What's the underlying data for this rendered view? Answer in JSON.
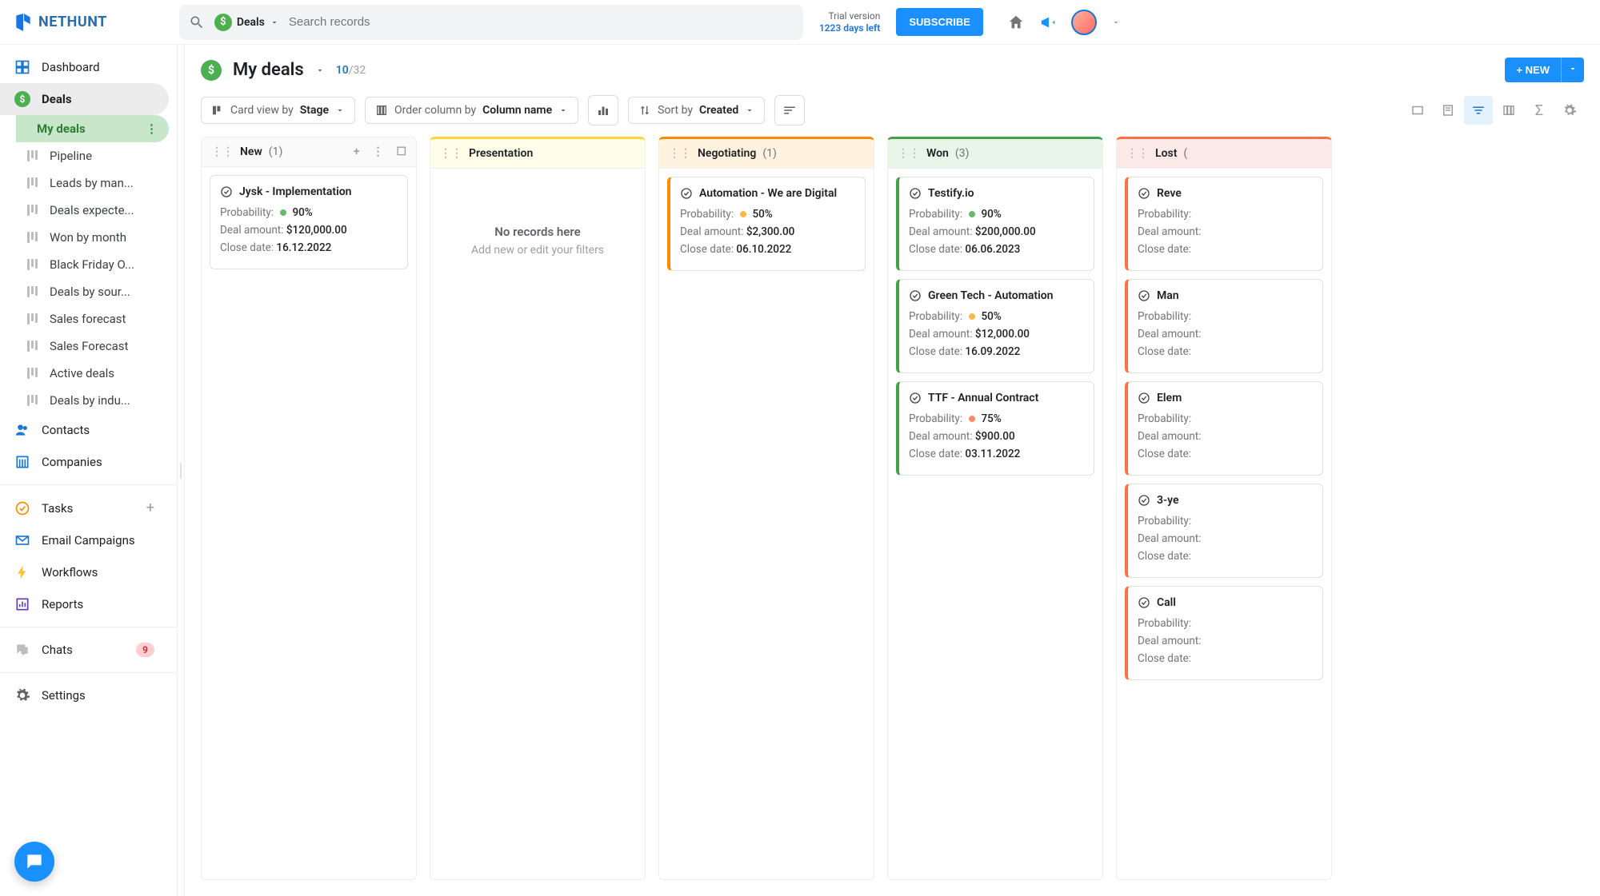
{
  "header": {
    "logo_text": "NETHUNT",
    "search_context": "Deals",
    "search_placeholder": "Search records",
    "trial_label": "Trial version",
    "trial_days": "1223 days left",
    "subscribe_label": "SUBSCRIBE"
  },
  "sidebar": {
    "dashboard": "Dashboard",
    "deals": "Deals",
    "subviews": [
      "My deals",
      "Pipeline",
      "Leads by man...",
      "Deals expecte...",
      "Won by month",
      "Black Friday O...",
      "Deals by sour...",
      "Sales forecast",
      "Sales Forecast",
      "Active deals",
      "Deals by indu..."
    ],
    "contacts": "Contacts",
    "companies": "Companies",
    "tasks": "Tasks",
    "email": "Email Campaigns",
    "workflows": "Workflows",
    "reports": "Reports",
    "chats": "Chats",
    "chats_badge": "9",
    "settings": "Settings"
  },
  "page": {
    "title": "My deals",
    "count_shown": "10",
    "count_total": "/32",
    "new_button": "+ NEW"
  },
  "toolbar": {
    "cardview_label": "Card view by",
    "cardview_value": "Stage",
    "order_label": "Order column by",
    "order_value": "Column name",
    "sort_label": "Sort by",
    "sort_value": "Created"
  },
  "board": {
    "columns": [
      {
        "key": "new",
        "name": "New",
        "count": "(1)",
        "class": "new"
      },
      {
        "key": "presentation",
        "name": "Presentation",
        "count": "",
        "class": "presentation"
      },
      {
        "key": "negotiating",
        "name": "Negotiating",
        "count": "(1)",
        "class": "negotiating"
      },
      {
        "key": "won",
        "name": "Won",
        "count": "(3)",
        "class": "won"
      },
      {
        "key": "lost",
        "name": "Lost",
        "count": "(",
        "class": "lost"
      }
    ],
    "empty_title": "No records here",
    "empty_sub": "Add new or edit your filters",
    "field_probability": "Probability:",
    "field_amount": "Deal amount:",
    "field_close": "Close date:"
  },
  "cards": {
    "new": [
      {
        "title": "Jysk - Implementation",
        "prob": "90%",
        "probClass": "green",
        "amount": "$120,000.00",
        "close": "16.12.2022",
        "cls": ""
      }
    ],
    "presentation": [],
    "negotiating": [
      {
        "title": "Automation - We are Digital",
        "prob": "50%",
        "probClass": "yellow",
        "amount": "$2,300.00",
        "close": "06.10.2022",
        "cls": "neg"
      }
    ],
    "won": [
      {
        "title": "Testify.io",
        "prob": "90%",
        "probClass": "green",
        "amount": "$200,000.00",
        "close": "06.06.2023",
        "cls": "won"
      },
      {
        "title": "Green Tech - Automation",
        "prob": "50%",
        "probClass": "yellow",
        "amount": "$12,000.00",
        "close": "16.09.2022",
        "cls": "won"
      },
      {
        "title": "TTF - Annual Contract",
        "prob": "75%",
        "probClass": "orange",
        "amount": "$900.00",
        "close": "03.11.2022",
        "cls": "won"
      }
    ],
    "lost": [
      {
        "title": "Reve",
        "prob": "",
        "probClass": "",
        "amount": "",
        "close": "",
        "cls": "lost"
      },
      {
        "title": "Man",
        "prob": "",
        "probClass": "",
        "amount": "",
        "close": "",
        "cls": "lost"
      },
      {
        "title": "Elem",
        "prob": "",
        "probClass": "",
        "amount": "",
        "close": "",
        "cls": "lost"
      },
      {
        "title": "3-ye",
        "prob": "",
        "probClass": "",
        "amount": "",
        "close": "",
        "cls": "lost"
      },
      {
        "title": "Call",
        "prob": "",
        "probClass": "",
        "amount": "",
        "close": "",
        "cls": "lost"
      }
    ]
  }
}
